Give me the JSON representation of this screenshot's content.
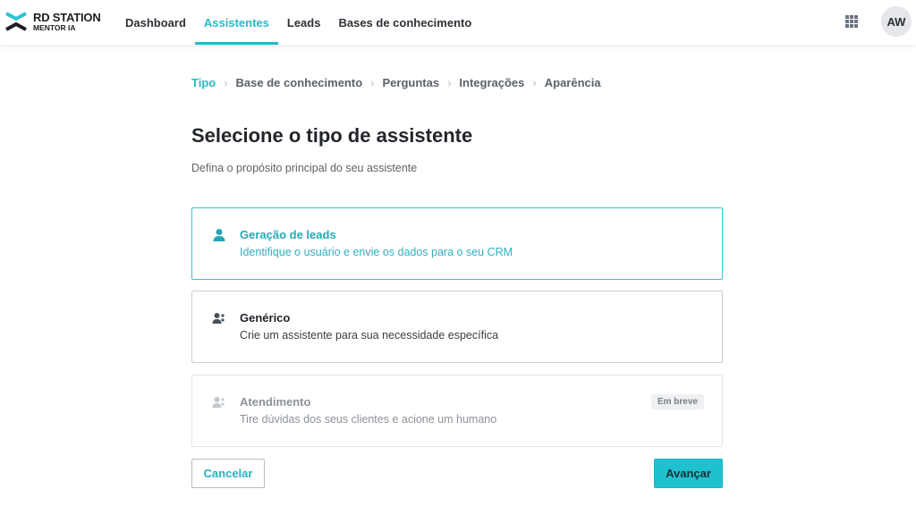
{
  "brand": {
    "line1": "RD STATION",
    "line2": "MENTOR IA",
    "colors": {
      "accent": "#27b9c9",
      "dark": "#1b1f24"
    }
  },
  "nav": {
    "items": [
      {
        "label": "Dashboard",
        "active": false
      },
      {
        "label": "Assistentes",
        "active": true
      },
      {
        "label": "Leads",
        "active": false
      },
      {
        "label": "Bases de conhecimento",
        "active": false
      }
    ],
    "apps_icon": "grid-icon",
    "avatar_initials": "AW"
  },
  "breadcrumb": {
    "steps": [
      {
        "label": "Tipo",
        "active": true
      },
      {
        "label": "Base de conhecimento",
        "active": false
      },
      {
        "label": "Perguntas",
        "active": false
      },
      {
        "label": "Integrações",
        "active": false
      },
      {
        "label": "Aparência",
        "active": false
      }
    ],
    "separator": "›"
  },
  "page": {
    "title": "Selecione o tipo de assistente",
    "subtitle": "Defina o propósito principal do seu assistente"
  },
  "options": [
    {
      "title": "Geração de leads",
      "description": "Identifique o usuário e envie os dados para o seu CRM",
      "icon": "user-icon",
      "state": "selected"
    },
    {
      "title": "Genérico",
      "description": "Crie um assistente para sua necessidade específica",
      "icon": "users-icon",
      "state": "default"
    },
    {
      "title": "Atendimento",
      "description": "Tire dúvidas dos seus clientes e acione um humano",
      "icon": "users-icon",
      "state": "disabled",
      "badge": "Em breve"
    }
  ],
  "actions": {
    "cancel_label": "Cancelar",
    "next_label": "Avançar"
  }
}
